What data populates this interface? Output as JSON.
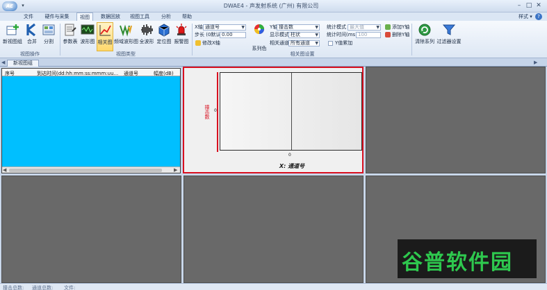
{
  "window": {
    "logo": "AE",
    "title": "DWAE4 - 声发射系统 (广州) 有限公司"
  },
  "tabs": [
    "文件",
    "硬件与采集",
    "视图",
    "数据回放",
    "视图工具",
    "分析",
    "帮助"
  ],
  "active_tab": 2,
  "style_menu": "样式",
  "ribbon": {
    "view_ops": {
      "buttons": [
        "新视图组",
        "合并",
        "分割"
      ],
      "label": "视图操作"
    },
    "view_types": {
      "buttons": [
        "参数表",
        "波形图",
        "相关图",
        "频域波形图",
        "全波形",
        "定位图",
        "报警图"
      ],
      "active": 2,
      "label": "视图类型"
    },
    "settings": {
      "label": "相关图设置",
      "x_axis_label": "X轴",
      "x_axis_value": "通道号",
      "step_label": "步长 (0默认)",
      "step_value": "0.00",
      "modify_x": "修改X轴",
      "series_color": "系列色",
      "y_axis_label": "Y轴",
      "y_axis_value": "撞击数",
      "display_mode_label": "显示模式",
      "display_mode_value": "柱状",
      "related_channel_label": "相关通道",
      "related_channel_value": "所有通道",
      "stat_mode_label": "统计模式",
      "stat_mode_value": "最大值",
      "stat_time_label": "统计时间(ms)",
      "stat_time_value": "100",
      "y_add": "Y值累加",
      "add_y": "添加Y轴",
      "del_y": "删除Y轴"
    },
    "clear_series": "清除系列",
    "filter_settings": "过滤器设置"
  },
  "doc_tab": "新视图组",
  "table": {
    "columns": [
      "序号",
      "到达时间(dd:hh:mm:ss:mmm:uu...",
      "通道号",
      "幅度(dB)"
    ]
  },
  "chart_data": {
    "type": "bar",
    "xlabel": "X: 通道号",
    "ylabel": "撞击数",
    "x_ticks": [
      "0"
    ],
    "y_ticks": [
      "0"
    ],
    "categories": [],
    "values": []
  },
  "watermark": "谷普软件园",
  "status": [
    "撞击总数:",
    "通道总数:",
    "文件:"
  ]
}
